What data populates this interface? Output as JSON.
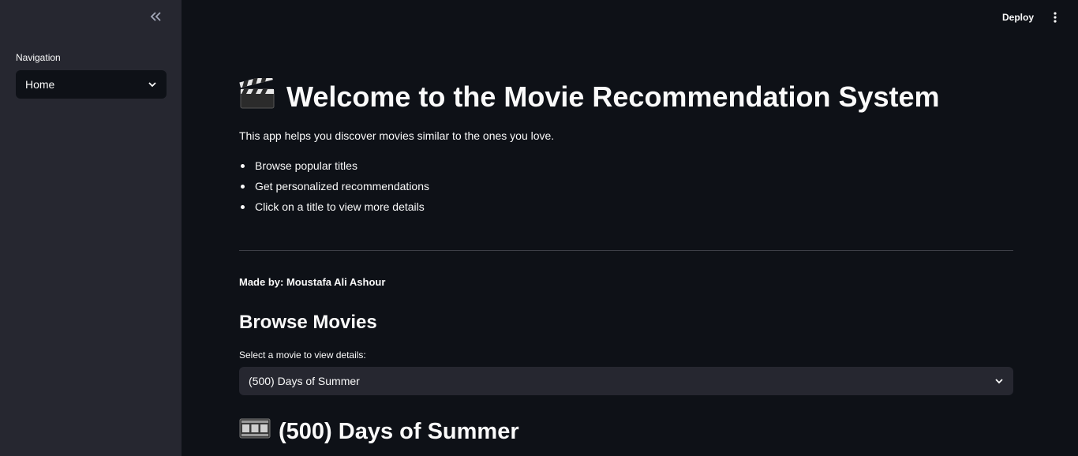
{
  "sidebar": {
    "collapse_icon": "double-chevron-left-icon",
    "nav_label": "Navigation",
    "nav_selected": "Home"
  },
  "topbar": {
    "deploy_label": "Deploy",
    "menu_icon": "vertical-ellipsis-icon"
  },
  "main": {
    "title": "Welcome to the Movie Recommendation System",
    "title_icon": "clapperboard-icon",
    "intro": "This app helps you discover movies similar to the ones you love.",
    "bullets": [
      "Browse popular titles",
      "Get personalized recommendations",
      "Click on a title to view more details"
    ],
    "made_by": "Made by: Moustafa Ali Ashour",
    "browse_title": "Browse Movies",
    "select_label": "Select a movie to view details:",
    "selected_movie": "(500) Days of Summer",
    "movie_heading": "(500) Days of Summer",
    "movie_heading_icon": "film-frames-icon"
  },
  "colors": {
    "background": "#0e1117",
    "sidebar": "#262730",
    "text": "#fafafa"
  }
}
